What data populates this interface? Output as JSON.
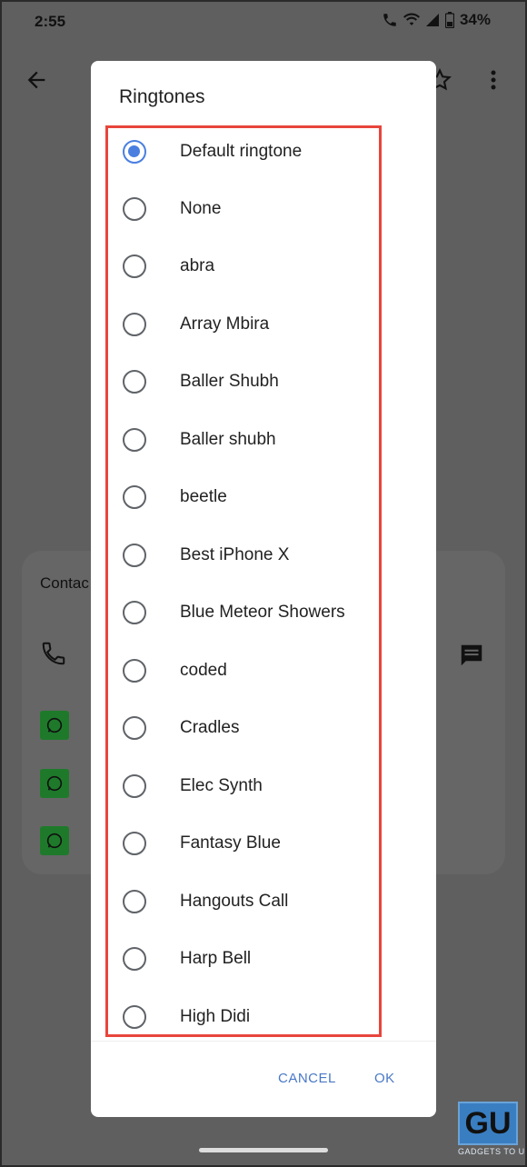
{
  "status_bar": {
    "time": "2:55",
    "battery": "34%"
  },
  "background": {
    "contact_section_title": "Contac"
  },
  "dialog": {
    "title": "Ringtones",
    "options": [
      {
        "label": "Default ringtone",
        "selected": true
      },
      {
        "label": "None",
        "selected": false
      },
      {
        "label": "abra",
        "selected": false
      },
      {
        "label": "Array Mbira",
        "selected": false
      },
      {
        "label": "Baller Shubh",
        "selected": false
      },
      {
        "label": "Baller shubh",
        "selected": false
      },
      {
        "label": "beetle",
        "selected": false
      },
      {
        "label": "Best iPhone X",
        "selected": false
      },
      {
        "label": "Blue Meteor Showers",
        "selected": false
      },
      {
        "label": "coded",
        "selected": false
      },
      {
        "label": "Cradles",
        "selected": false
      },
      {
        "label": "Elec Synth",
        "selected": false
      },
      {
        "label": "Fantasy Blue",
        "selected": false
      },
      {
        "label": "Hangouts Call",
        "selected": false
      },
      {
        "label": "Harp Bell",
        "selected": false
      },
      {
        "label": "High Didi",
        "selected": false
      }
    ],
    "cancel_label": "CANCEL",
    "ok_label": "OK"
  },
  "watermark": {
    "logo_text": "GU",
    "text": "GADGETS TO USE"
  },
  "colors": {
    "accent": "#4a7fe0",
    "highlight_border": "#e8453c",
    "scrim": "#5f5f5f"
  }
}
